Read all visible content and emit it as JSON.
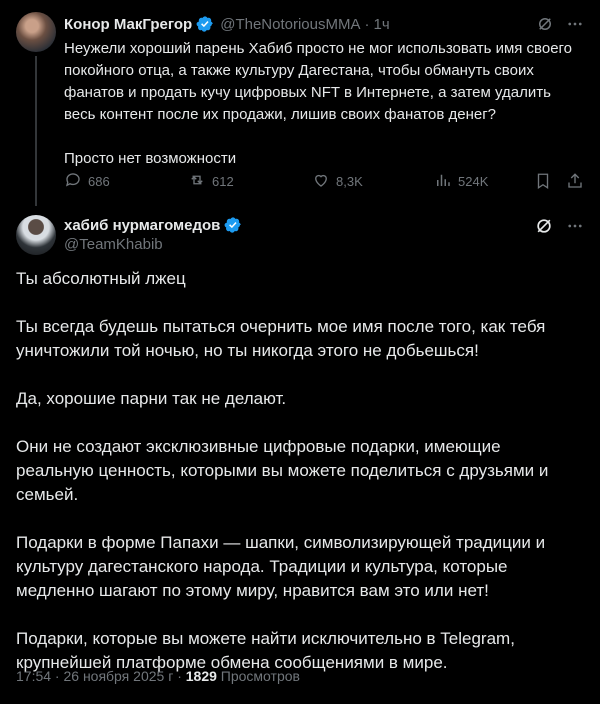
{
  "reply_context": {
    "author_name": "Конор МакГрегор",
    "handle": "@TheNotoriousMMA",
    "separator": "·",
    "time": "1ч",
    "text": "Неужели хороший парень Хабиб просто не мог использовать имя своего покойного отца, а также культуру Дагестана, чтобы обмануть своих фанатов и продать кучу цифровых NFT в Интернете, а затем удалить весь контент после их продажи, лишив своих фанатов денег?\n\nПросто нет возможности",
    "stats": {
      "replies": "686",
      "reposts": "612",
      "likes": "8,3K",
      "views": "524K"
    }
  },
  "main_tweet": {
    "author_name": "хабиб нурмагомедов",
    "handle": "@TeamKhabib",
    "paragraphs": [
      "Ты абсолютный лжец",
      "Ты всегда будешь пытаться очернить мое имя после того, как тебя уничтожили той ночью, но ты никогда этого не добьешься!",
      "Да, хорошие парни так не делают.",
      "Они не создают эксклюзивные цифровые подарки, имеющие реальную ценность, которыми вы можете поделиться с друзьями и семьей.",
      "Подарки в форме Папахи — шапки, символизирующей традиции и культуру дагестанского народа. Традиции и культура, которые медленно шагают по этому миру, нравится вам это или нет!",
      "Подарки, которые вы можете найти исключительно в Telegram, крупнейшей платформе обмена сообщениями в мире."
    ],
    "timestamp": "17:54 · 26 ноября 2025 г",
    "meta_separator": "·",
    "views_count": "1829",
    "views_label": "Просмотров"
  },
  "colors": {
    "background": "#000000",
    "text": "#e7e9ea",
    "muted": "#71767b",
    "verified": "#1d9bf0",
    "divider": "#333639"
  },
  "icons": [
    "verified-badge-icon",
    "grok-icon",
    "more-icon",
    "reply-icon",
    "repost-icon",
    "like-icon",
    "views-icon",
    "bookmark-icon",
    "share-icon"
  ]
}
